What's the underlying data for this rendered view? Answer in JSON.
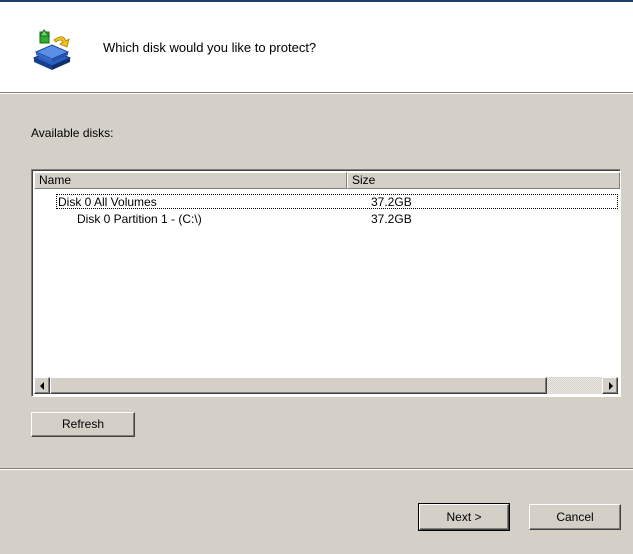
{
  "header": {
    "title": "Which disk would you like to protect?",
    "icon": "disk-protect-icon"
  },
  "available_label": "Available disks:",
  "disk_list": {
    "columns": [
      "Name",
      "Size"
    ],
    "rows": [
      {
        "name": "Disk 0 All Volumes",
        "size": "37.2GB",
        "selected": true
      },
      {
        "name": "Disk 0 Partition 1 - (C:\\)",
        "size": "37.2GB",
        "selected": false
      }
    ]
  },
  "buttons": {
    "refresh": "Refresh",
    "next": "Next >",
    "cancel": "Cancel"
  },
  "colors": {
    "dialog_bg": "#d4d0c8",
    "header_bg": "#ffffff"
  }
}
